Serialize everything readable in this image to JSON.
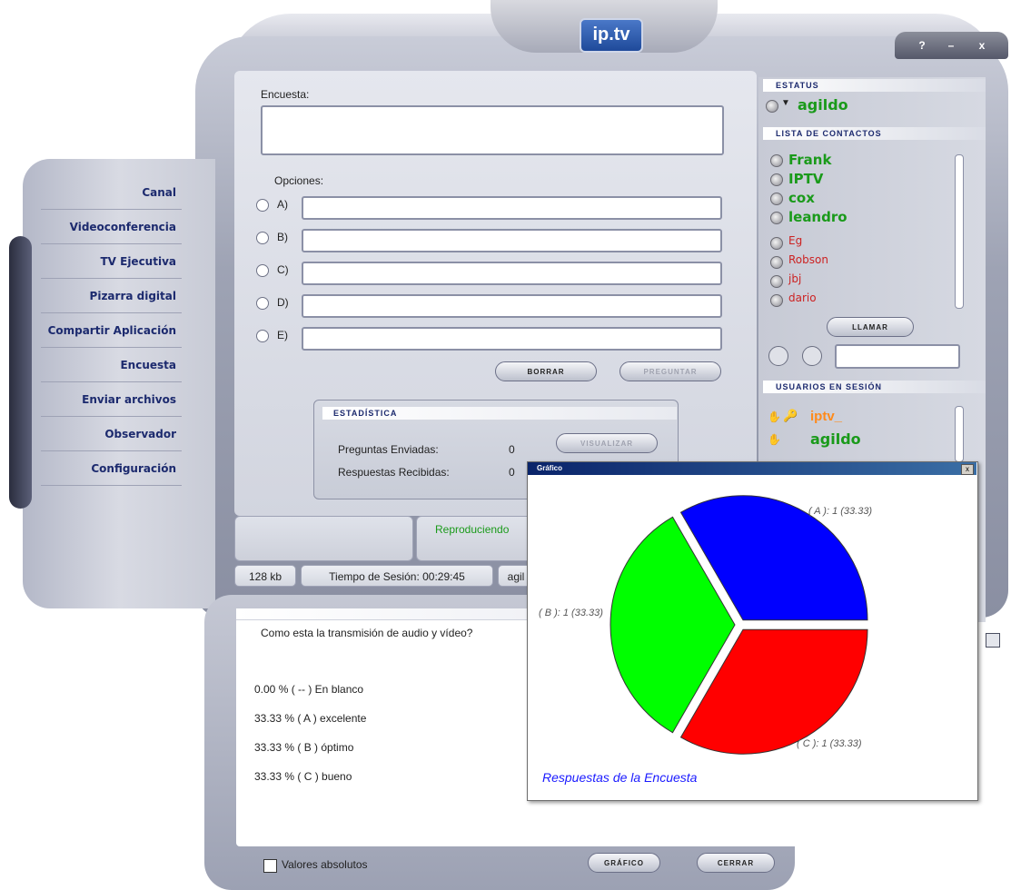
{
  "app": {
    "logo": "ip.tv"
  },
  "window_buttons": {
    "help": "?",
    "minimize": "–",
    "close": "x"
  },
  "nav": {
    "items": [
      {
        "label": "Canal"
      },
      {
        "label": "Videoconferencia"
      },
      {
        "label": "TV Ejecutiva"
      },
      {
        "label": "Pizarra digital"
      },
      {
        "label": "Compartir Aplicación"
      },
      {
        "label": "Encuesta"
      },
      {
        "label": "Enviar archivos"
      },
      {
        "label": "Observador"
      },
      {
        "label": "Configuración"
      }
    ]
  },
  "poll": {
    "encuesta_label": "Encuesta:",
    "encuesta_value": "",
    "opciones_label": "Opciones:",
    "options": [
      {
        "key": "A)",
        "value": ""
      },
      {
        "key": "B)",
        "value": ""
      },
      {
        "key": "C)",
        "value": ""
      },
      {
        "key": "D)",
        "value": ""
      },
      {
        "key": "E)",
        "value": ""
      }
    ],
    "borrar_label": "BORRAR",
    "preguntar_label": "PREGUNTAR"
  },
  "stats": {
    "header": "ESTADÍSTICA",
    "sent_label": "Preguntas Enviadas:",
    "sent_value": "0",
    "received_label": "Respuestas Recibidas:",
    "received_value": "0",
    "visualizar_label": "VISUALIZAR"
  },
  "status_bar": {
    "playing": "Reproduciendo",
    "bitrate": "128 kb",
    "session_time": "Tiempo de Sesión: 00:29:45",
    "user": "agil"
  },
  "right": {
    "status_header": "ESTATUS",
    "status_user": "agildo",
    "contacts_header": "LISTA DE CONTACTOS",
    "contacts": [
      {
        "name": "Frank"
      },
      {
        "name": "IPTV"
      },
      {
        "name": "cox"
      },
      {
        "name": "leandro"
      },
      {
        "name": "Eg"
      },
      {
        "name": "Robson"
      },
      {
        "name": "jbj"
      },
      {
        "name": "dario"
      }
    ],
    "llamar_label": "LLAMAR",
    "call_input": "",
    "session_header": "USUARIOS EN SESIÓN",
    "session_users": [
      {
        "name": "iptv_"
      },
      {
        "name": "agildo"
      }
    ]
  },
  "results": {
    "question": "Como esta la transmisión de audio y vídeo?",
    "rows": [
      {
        "text": "0.00 % ( -- )  En blanco"
      },
      {
        "text": "33.33 % ( A )  excelente"
      },
      {
        "text": "33.33 % ( B )  óptimo"
      },
      {
        "text": "33.33 % ( C )  bueno"
      }
    ],
    "absolute_label": "Valores absolutos",
    "grafico_label": "GRÁFICO",
    "cerrar_label": "CERRAR"
  },
  "chart_window": {
    "title": "Gráfico",
    "close": "x"
  },
  "chart_data": {
    "type": "pie",
    "title": "Respuestas de la Encuesta",
    "slices": [
      {
        "label": "( A ): 1 (33.33)",
        "value": 1,
        "color": "#0000ff"
      },
      {
        "label": "( C ): 1 (33.33)",
        "value": 1,
        "color": "#ff0000"
      },
      {
        "label": "( B ): 1 (33.33)",
        "value": 1,
        "color": "#00ff00"
      }
    ]
  }
}
